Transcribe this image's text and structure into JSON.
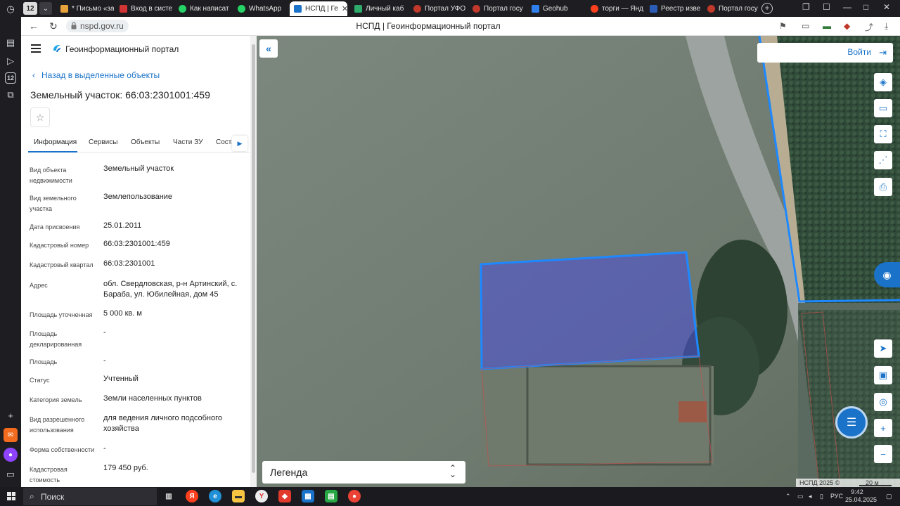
{
  "browser": {
    "tab_count": "12",
    "tabs": [
      {
        "label": "* Письмо «за",
        "color": "#e8a23b"
      },
      {
        "label": "Вход в систе",
        "color": "#d13434"
      },
      {
        "label": "Как написат",
        "color": "#25d366"
      },
      {
        "label": "WhatsApp",
        "color": "#25d366"
      },
      {
        "label": "НСПД | Ге",
        "color": "#1a73c9"
      },
      {
        "label": "Личный каб",
        "color": "#2eaa6a"
      },
      {
        "label": "Портал УФО",
        "color": "#c0392b"
      },
      {
        "label": "Портал госу",
        "color": "#c0392b"
      },
      {
        "label": "Geohub",
        "color": "#2f80ed"
      },
      {
        "label": "торги — Янд",
        "color": "#fc3f1d"
      },
      {
        "label": "Реестр изве",
        "color": "#2b5db8"
      },
      {
        "label": "Портал госу",
        "color": "#c0392b"
      }
    ],
    "url": "nspd.gov.ru",
    "page_title": "НСПД | Геоинформационный портал"
  },
  "panel": {
    "portal_name": "Геоинформационный портал",
    "back_link": "Назад в выделенные объекты",
    "title": "Земельный участок: 66:03:2301001:459",
    "tabs": [
      "Информация",
      "Сервисы",
      "Объекты",
      "Части ЗУ",
      "Соста"
    ],
    "fields": [
      {
        "label": "Вид объекта недвижимости",
        "value": "Земельный участок"
      },
      {
        "label": "Вид земельного участка",
        "value": "Землепользование"
      },
      {
        "label": "Дата присвоения",
        "value": "25.01.2011"
      },
      {
        "label": "Кадастровый номер",
        "value": "66:03:2301001:459"
      },
      {
        "label": "Кадастровый квартал",
        "value": "66:03:2301001"
      },
      {
        "label": "Адрес",
        "value": "обл. Свердловская, р-н Артинский, с. Бараба, ул. Юбилейная, дом 45"
      },
      {
        "label": "Площадь уточненная",
        "value": "5 000 кв. м"
      },
      {
        "label": "Площадь декларированная",
        "value": "-"
      },
      {
        "label": "Площадь",
        "value": "-"
      },
      {
        "label": "Статус",
        "value": "Учтенный"
      },
      {
        "label": "Категория земель",
        "value": "Земли населенных пунктов"
      },
      {
        "label": "Вид разрешенного использования",
        "value": "для ведения личного подсобного хозяйства"
      },
      {
        "label": "Форма собственности",
        "value": "-"
      },
      {
        "label": "Кадастровая стоимость",
        "value": "179 450 руб."
      }
    ]
  },
  "map": {
    "login_label": "Войти",
    "legend_label": "Легенда",
    "attribution": "НСПД 2025 ©",
    "scale": "20 м",
    "parcel_color": "#4b4fd8",
    "boundary_color": "#1e88ff"
  },
  "taskbar": {
    "search_label": "Поиск",
    "language": "РУС",
    "time": "9:42",
    "date": "25.04.2025"
  }
}
